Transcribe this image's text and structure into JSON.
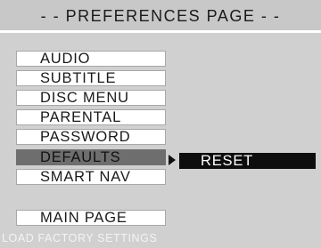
{
  "header": {
    "title": "- - PREFERENCES PAGE - -"
  },
  "menu": {
    "items": [
      {
        "label": "AUDIO"
      },
      {
        "label": "SUBTITLE"
      },
      {
        "label": "DISC MENU"
      },
      {
        "label": "PARENTAL"
      },
      {
        "label": "PASSWORD"
      },
      {
        "label": "DEFAULTS",
        "selected": true
      },
      {
        "label": "SMART NAV"
      }
    ],
    "main_page": "MAIN PAGE"
  },
  "submenu": {
    "items": [
      {
        "label": "RESET"
      }
    ]
  },
  "status": {
    "help_text": "LOAD FACTORY SETTINGS"
  },
  "colors": {
    "header_bg": "#c8c8c8",
    "panel_bg": "#d0d0d0",
    "selected_bg": "#6e6e6e",
    "submenu_bg": "#0d0d0d"
  }
}
